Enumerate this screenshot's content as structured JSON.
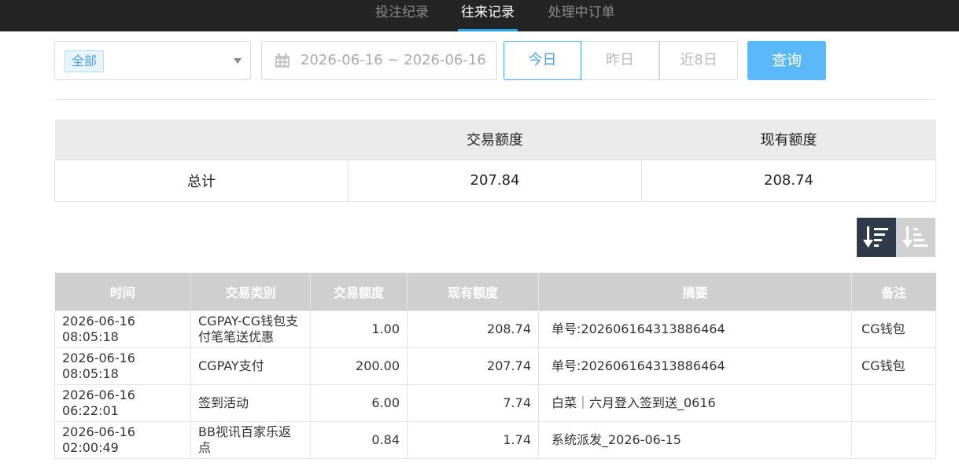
{
  "tabs": [
    {
      "label": "投注纪录"
    },
    {
      "label": "往来记录"
    },
    {
      "label": "处理中订单"
    }
  ],
  "filters": {
    "type_select": {
      "selected": "全部"
    },
    "date_range": "2026-06-16 ~ 2026-06-16",
    "quick_dates": [
      "今日",
      "昨日",
      "近8日"
    ],
    "search_label": "查询"
  },
  "summary": {
    "headers": [
      "",
      "交易额度",
      "现有额度"
    ],
    "row": {
      "label": "总计",
      "amount": "207.84",
      "balance": "208.74"
    }
  },
  "sort": {
    "active": "desc",
    "icons": [
      "sort-desc-icon",
      "sort-asc-icon"
    ]
  },
  "table": {
    "headers": [
      "时间",
      "交易类别",
      "交易额度",
      "现有额度",
      "摘要",
      "备注"
    ],
    "rows": [
      {
        "time": "2026-06-16 08:05:18",
        "category": "CGPAY-CG钱包支付笔笔送优惠",
        "amount": "1.00",
        "balance": "208.74",
        "summary": "单号:20260616431388646​4",
        "note": "CG钱包"
      },
      {
        "time": "2026-06-16 08:05:18",
        "category": "CGPAY支付",
        "amount": "200.00",
        "balance": "207.74",
        "summary": "单号:202606164313886464",
        "note": "CG钱包"
      },
      {
        "time": "2026-06-16 06:22:01",
        "category": "签到活动",
        "amount": "6.00",
        "balance": "7.74",
        "summary": "白菜｜六月登入签到送_0616",
        "note": ""
      },
      {
        "time": "2026-06-16 02:00:49",
        "category": "BB视讯百家乐返点",
        "amount": "0.84",
        "balance": "1.74",
        "summary": "系统派发_2026-06-15",
        "note": ""
      }
    ]
  },
  "colors": {
    "accent": "#42a5f5",
    "button": "#5bb8f9",
    "topbar": "#242424",
    "header_bg": "#cfcfcf"
  }
}
